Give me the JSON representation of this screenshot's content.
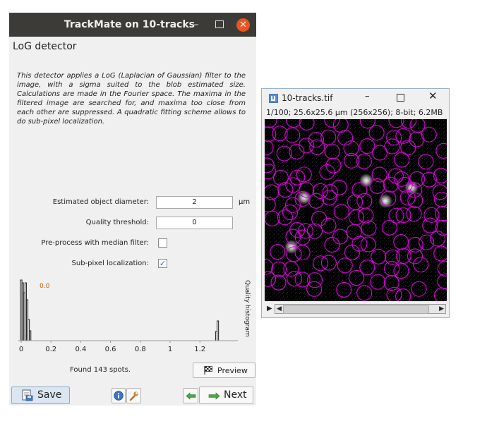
{
  "trackmate": {
    "title": "TrackMate on 10-tracks",
    "detector_title": "LoG detector",
    "description": "This detector applies a LoG (Laplacian of Gaussian) filter to the image, with a sigma suited to the blob estimated size. Calculations are made in the Fourier space. The maxima in the filtered image are searched for, and maxima too close from each other are suppressed. A quadratic fitting scheme allows to do sub-pixel localization.",
    "fields": {
      "diameter_label": "Estimated object diameter:",
      "diameter_value": "2",
      "diameter_unit": "µm",
      "quality_label": "Quality threshold:",
      "quality_value": "0",
      "median_label": "Pre-process with median filter:",
      "median_checked": false,
      "subpixel_label": "Sub-pixel localization:",
      "subpixel_checked": true,
      "subpixel_check_glyph": "✓"
    },
    "histogram": {
      "threshold_label": "0.0",
      "side_label": "Quality histogram",
      "x_ticks": [
        "0",
        "0.2",
        "0.4",
        "0.6",
        "0.8",
        "1",
        "1.2"
      ],
      "threshold_color": "#c0600a"
    },
    "found_text": "Found 143 spots.",
    "buttons": {
      "preview": "Preview",
      "save": "Save",
      "next": "Next",
      "info_icon": "info-icon",
      "tool_icon": "wrench-icon",
      "back_icon": "arrow-left-icon"
    },
    "window_controls": {
      "minimize": "–",
      "close": "✕"
    },
    "colors": {
      "titlebar": "#3c3b37",
      "close": "#e9541f",
      "save_button": "#dbe6f3"
    }
  },
  "image_window": {
    "title": "10-tracks.tif",
    "info": "1/100; 25.6x25.6 µm (256x256); 8-bit; 6.2MB",
    "controls": {
      "minimize": "–",
      "close": "✕"
    },
    "play_glyph": "▶",
    "scroll_left_glyph": "◀",
    "scroll_right_glyph": "▶",
    "overlay_color": "#d400d4",
    "background_color": "#000000"
  }
}
